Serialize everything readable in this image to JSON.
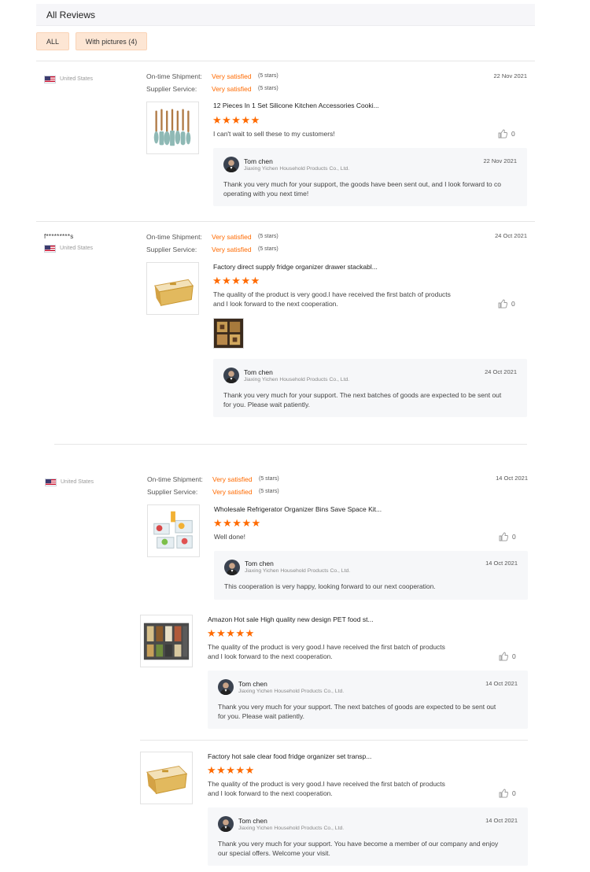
{
  "header": {
    "title": "All Reviews"
  },
  "filters": {
    "all_label": "ALL",
    "pictures_label": "With pictures (4)"
  },
  "meta_labels": {
    "shipment": "On-time Shipment:",
    "service": "Supplier Service:"
  },
  "reviews": [
    {
      "username": "",
      "country": "United States",
      "shipment": "Very satisfied",
      "shipment_stars": "(5 stars)",
      "service": "Very satisfied",
      "service_stars": "(5 stars)",
      "date": "22 Nov 2021",
      "items": [
        {
          "product_title": "12 Pieces In 1 Set Silicone Kitchen Accessories Cooki...",
          "rating": "★★★★★",
          "rating_value": 5,
          "text_line1": "I can't wait to sell these to my customers!",
          "text_line2": "",
          "likes": "0",
          "reply": {
            "name": "Tom chen",
            "company": "Jiaxing Yichen Household Products Co., Ltd.",
            "date": "22 Nov 2021",
            "text_line1": "Thank you very much for your support, the goods have been sent out, and I look forward to co",
            "text_line2": "operating with you next time!"
          }
        }
      ]
    },
    {
      "username": "f*********s",
      "country": "United States",
      "shipment": "Very satisfied",
      "shipment_stars": "(5 stars)",
      "service": "Very satisfied",
      "service_stars": "(5 stars)",
      "date": "24 Oct 2021",
      "items": [
        {
          "product_title": "Factory direct supply fridge organizer drawer stackabl...",
          "rating": "★★★★★",
          "rating_value": 5,
          "text_line1": "The quality of the product is very good.I have received the first batch of products",
          "text_line2": "and I look forward to the next cooperation.",
          "likes": "0",
          "reply": {
            "name": "Tom chen",
            "company": "Jiaxing Yichen Household Products Co., Ltd.",
            "date": "24 Oct 2021",
            "text_line1": "Thank you very much for your support. The next batches of goods are expected to be sent out",
            "text_line2": "for you. Please wait patiently."
          }
        }
      ]
    },
    {
      "username": "",
      "country": "United States",
      "shipment": "Very satisfied",
      "shipment_stars": "(5 stars)",
      "service": "Very satisfied",
      "service_stars": "(5 stars)",
      "date": "14 Oct 2021",
      "items": [
        {
          "product_title": "Wholesale Refrigerator Organizer Bins Save Space Kit...",
          "rating": "★★★★★",
          "rating_value": 5,
          "text_line1": "Well done!",
          "text_line2": "",
          "likes": "0",
          "reply": {
            "name": "Tom chen",
            "company": "Jiaxing Yichen Household Products Co., Ltd.",
            "date": "14 Oct 2021",
            "text_line1": "This cooperation is very happy, looking forward to our next cooperation.",
            "text_line2": ""
          }
        },
        {
          "product_title": "Amazon Hot sale High quality new design PET food st...",
          "rating": "★★★★★",
          "rating_value": 5,
          "text_line1": "The quality of the product is very good.I have received the first batch of products",
          "text_line2": "and I look forward to the next cooperation.",
          "likes": "0",
          "reply": {
            "name": "Tom chen",
            "company": "Jiaxing Yichen Household Products Co., Ltd.",
            "date": "14 Oct 2021",
            "text_line1": "Thank you very much for your support. The next batches of goods are expected to be sent out",
            "text_line2": "for you. Please wait patiently."
          }
        },
        {
          "product_title": "Factory hot sale clear food fridge organizer set transp...",
          "rating": "★★★★★",
          "rating_value": 5,
          "text_line1": "The quality of the product is very good.I have received the first batch of products",
          "text_line2": "and I look forward to the next cooperation.",
          "likes": "0",
          "reply": {
            "name": "Tom chen",
            "company": "Jiaxing Yichen Household Products Co., Ltd.",
            "date": "14 Oct 2021",
            "text_line1": "Thank you very much for your support. You have become a member of our company and enjoy",
            "text_line2": "our special offers. Welcome your visit."
          }
        }
      ]
    }
  ],
  "colors": {
    "accent": "#ff6a00",
    "filter_bg": "#fde6d4",
    "reply_bg": "#f6f7f9"
  },
  "icons": {
    "like": "thumbs-up-icon",
    "flag": "us-flag-icon",
    "star": "star-icon"
  }
}
